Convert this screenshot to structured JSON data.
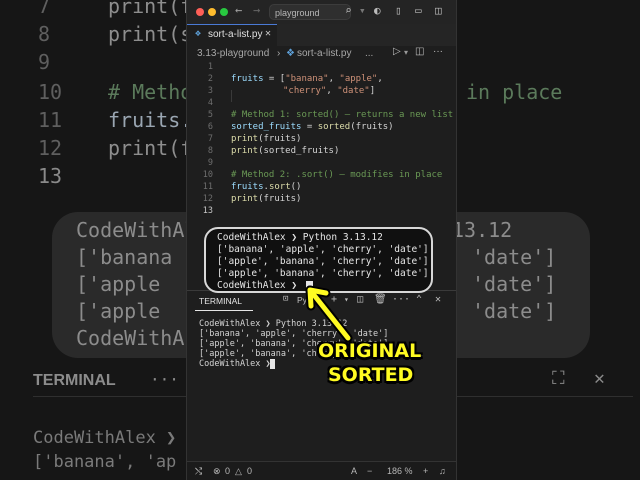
{
  "background": {
    "lines": [
      {
        "num": "7",
        "code": "print(f"
      },
      {
        "num": "8",
        "code": "print(s"
      },
      {
        "num": "9",
        "code": ""
      },
      {
        "num": "10",
        "code": "# Metho"
      },
      {
        "num": "11",
        "code": "fruits."
      },
      {
        "num": "12",
        "code": "print(f"
      },
      {
        "num": "13",
        "code": ""
      }
    ],
    "tail_text": "in place",
    "term": [
      "CodeWithAlex ❯",
      "['banana",
      "['apple",
      "['apple",
      "CodeWithA"
    ],
    "term_right": [
      "13.12",
      "'date']",
      "'date']",
      "'date']"
    ],
    "panel_label": "TERMINAL",
    "bottom": [
      "CodeWithAlex ❯",
      "['banana', 'ap"
    ]
  },
  "window": {
    "titlebar": {
      "search_text": "playground"
    },
    "tab": {
      "label": "sort-a-list.py"
    },
    "breadcrumb": {
      "folder": "3.13-playground",
      "sep": "›",
      "file": "sort-a-list.py",
      "more": "..."
    },
    "editor_lines": [
      {
        "num": "1"
      },
      {
        "num": "2"
      },
      {
        "num": "3"
      },
      {
        "num": "4"
      },
      {
        "num": "5"
      },
      {
        "num": "6"
      },
      {
        "num": "7"
      },
      {
        "num": "8"
      },
      {
        "num": "9"
      },
      {
        "num": "10"
      },
      {
        "num": "11"
      },
      {
        "num": "12"
      },
      {
        "num": "13"
      }
    ],
    "code": {
      "l2_var": "fruits",
      "l2_eq": " = [",
      "l2_s1": "\"banana\"",
      "l2_comma": ", ",
      "l2_s2": "\"apple\"",
      "l2_tail": ",",
      "l3_s1": "\"cherry\"",
      "l3_comma": ", ",
      "l3_s2": "\"date\"",
      "l3_tail": "]",
      "l5": "# Method 1: sorted() — returns a new list",
      "l6_var": "sorted_fruits",
      "l6_eq": " = ",
      "l6_fn": "sorted",
      "l6_arg": "(fruits)",
      "l7_fn": "print",
      "l7_arg": "(fruits)",
      "l8_fn": "print",
      "l8_arg": "(sorted_fruits)",
      "l10": "# Method 2: .sort() — modifies in place",
      "l11_var": "fruits",
      "l11_dot": ".",
      "l11_fn": "sort",
      "l11_arg": "()",
      "l12_fn": "print",
      "l12_arg": "(fruits)"
    },
    "terminal": {
      "label": "TERMINAL",
      "shell": "Python",
      "lines": [
        "CodeWithAlex ❯ Python 3.13.12",
        "['banana', 'apple', 'cherry', 'date']",
        "['apple', 'banana', 'cherry', 'date']",
        "['apple', 'banana', 'cherry', 'date']",
        "CodeWithAlex ❯"
      ]
    },
    "status": {
      "errors": "0",
      "warnings": "0",
      "zoom": "186 %"
    }
  },
  "zoom_overlay": {
    "lines": [
      "CodeWithAlex ❯ Python 3.13.12",
      "['banana', 'apple', 'cherry', 'date']",
      "['apple', 'banana', 'cherry', 'date']",
      "['apple', 'banana', 'cherry', 'date']",
      "CodeWithAlex ❯"
    ]
  },
  "annotation": {
    "line1": "ORIGINAL",
    "line2": "SORTED",
    "color": "#fffb22"
  }
}
